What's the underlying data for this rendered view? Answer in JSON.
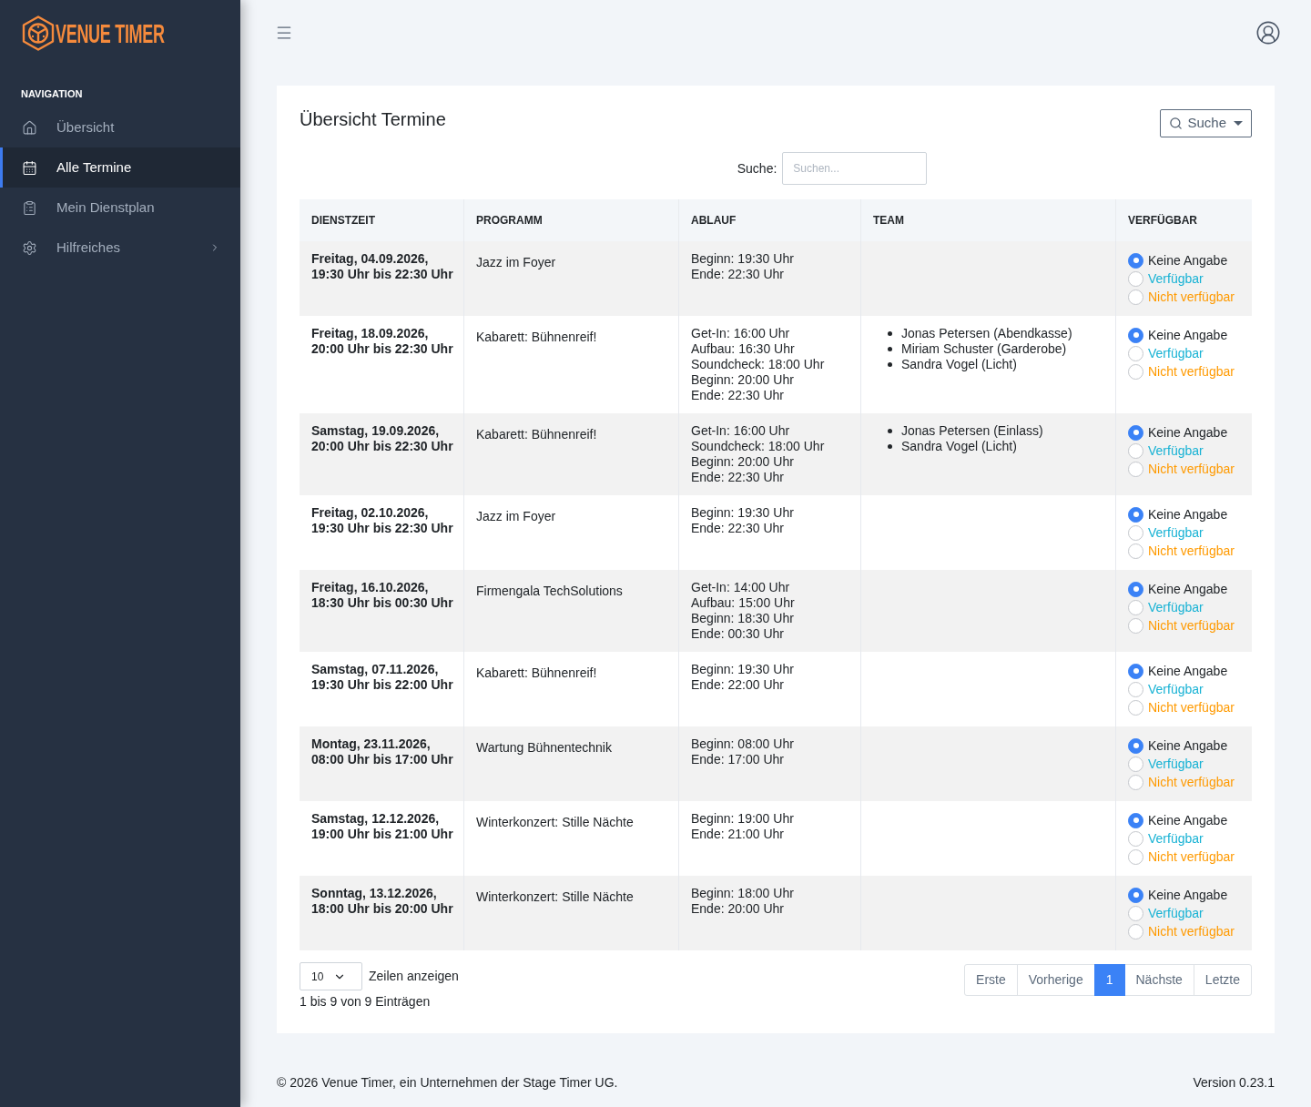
{
  "sidebar": {
    "logo": "VENUE TIMER",
    "section": "NAVIGATION",
    "items": [
      {
        "label": "Übersicht",
        "kind": "link",
        "selected": false
      },
      {
        "label": "Alle Termine",
        "kind": "link",
        "selected": true
      },
      {
        "label": "Mein Dienstplan",
        "kind": "link",
        "selected": false
      },
      {
        "label": "Hilfreiches",
        "kind": "submenu",
        "selected": false
      }
    ]
  },
  "card": {
    "title": "Übersicht Termine",
    "search_button": "Suche",
    "filter": {
      "label": "Suche:",
      "placeholder": "Suchen..."
    },
    "table": {
      "columns": [
        "DIENSTZEIT",
        "PROGRAMM",
        "ABLAUF",
        "TEAM",
        "VERFÜGBAR"
      ],
      "rows": [
        {
          "dienstzeit": [
            "Freitag, 04.09.2026,",
            "19:30 Uhr bis 22:30 Uhr"
          ],
          "programm": "Jazz im Foyer",
          "ablauf": [
            "Beginn: 19:30 Uhr",
            "Ende: 22:30 Uhr"
          ],
          "availability": [
            {
              "label": "Keine Angabe",
              "color": "#212529",
              "selected": true
            },
            {
              "label": "Verfügbar",
              "color": "#17b2d4",
              "selected": false
            },
            {
              "label": "Nicht verfügbar",
              "color": "#ff9a00",
              "selected": false
            }
          ]
        },
        {
          "dienstzeit": [
            "Freitag, 18.09.2026,",
            "20:00 Uhr bis 22:30 Uhr"
          ],
          "programm": "Kabarett: Bühnenreif!",
          "ablauf": [
            "Get-In: 16:00 Uhr",
            "Aufbau: 16:30 Uhr",
            "Soundcheck: 18:00 Uhr",
            "Beginn: 20:00 Uhr",
            "Ende: 22:30 Uhr"
          ],
          "team": [
            "Jonas Petersen (Abendkasse)",
            "Miriam Schuster (Garderobe)",
            "Sandra Vogel (Licht)"
          ],
          "availability": [
            {
              "label": "Keine Angabe",
              "color": "#212529",
              "selected": true
            },
            {
              "label": "Verfügbar",
              "color": "#17b2d4",
              "selected": false
            },
            {
              "label": "Nicht verfügbar",
              "color": "#ff9a00",
              "selected": false
            }
          ]
        },
        {
          "dienstzeit": [
            "Samstag, 19.09.2026,",
            "20:00 Uhr bis 22:30 Uhr"
          ],
          "programm": "Kabarett: Bühnenreif!",
          "ablauf": [
            "Get-In: 16:00 Uhr",
            "Soundcheck: 18:00 Uhr",
            "Beginn: 20:00 Uhr",
            "Ende: 22:30 Uhr"
          ],
          "team": [
            "Jonas Petersen (Einlass)",
            "Sandra Vogel (Licht)"
          ],
          "availability": [
            {
              "label": "Keine Angabe",
              "color": "#212529",
              "selected": true
            },
            {
              "label": "Verfügbar",
              "color": "#17b2d4",
              "selected": false
            },
            {
              "label": "Nicht verfügbar",
              "color": "#ff9a00",
              "selected": false
            }
          ]
        },
        {
          "dienstzeit": [
            "Freitag, 02.10.2026,",
            "19:30 Uhr bis 22:30 Uhr"
          ],
          "programm": "Jazz im Foyer",
          "ablauf": [
            "Beginn: 19:30 Uhr",
            "Ende: 22:30 Uhr"
          ],
          "availability": [
            {
              "label": "Keine Angabe",
              "color": "#212529",
              "selected": true
            },
            {
              "label": "Verfügbar",
              "color": "#17b2d4",
              "selected": false
            },
            {
              "label": "Nicht verfügbar",
              "color": "#ff9a00",
              "selected": false
            }
          ]
        },
        {
          "dienstzeit": [
            "Freitag, 16.10.2026,",
            "18:30 Uhr bis 00:30 Uhr"
          ],
          "programm": "Firmengala TechSolutions",
          "ablauf": [
            "Get-In: 14:00 Uhr",
            "Aufbau: 15:00 Uhr",
            "Beginn: 18:30 Uhr",
            "Ende: 00:30 Uhr"
          ],
          "availability": [
            {
              "label": "Keine Angabe",
              "color": "#212529",
              "selected": true
            },
            {
              "label": "Verfügbar",
              "color": "#17b2d4",
              "selected": false
            },
            {
              "label": "Nicht verfügbar",
              "color": "#ff9a00",
              "selected": false
            }
          ]
        },
        {
          "dienstzeit": [
            "Samstag, 07.11.2026,",
            "19:30 Uhr bis 22:00 Uhr"
          ],
          "programm": "Kabarett: Bühnenreif!",
          "ablauf": [
            "Beginn: 19:30 Uhr",
            "Ende: 22:00 Uhr"
          ],
          "availability": [
            {
              "label": "Keine Angabe",
              "color": "#212529",
              "selected": true
            },
            {
              "label": "Verfügbar",
              "color": "#17b2d4",
              "selected": false
            },
            {
              "label": "Nicht verfügbar",
              "color": "#ff9a00",
              "selected": false
            }
          ]
        },
        {
          "dienstzeit": [
            "Montag, 23.11.2026,",
            "08:00 Uhr bis 17:00 Uhr"
          ],
          "programm": "Wartung Bühnentechnik",
          "ablauf": [
            "Beginn: 08:00 Uhr",
            "Ende: 17:00 Uhr"
          ],
          "availability": [
            {
              "label": "Keine Angabe",
              "color": "#212529",
              "selected": true
            },
            {
              "label": "Verfügbar",
              "color": "#17b2d4",
              "selected": false
            },
            {
              "label": "Nicht verfügbar",
              "color": "#ff9a00",
              "selected": false
            }
          ]
        },
        {
          "dienstzeit": [
            "Samstag, 12.12.2026,",
            "19:00 Uhr bis 21:00 Uhr"
          ],
          "programm": "Winterkonzert: Stille Nächte",
          "ablauf": [
            "Beginn: 19:00 Uhr",
            "Ende: 21:00 Uhr"
          ],
          "availability": [
            {
              "label": "Keine Angabe",
              "color": "#212529",
              "selected": true
            },
            {
              "label": "Verfügbar",
              "color": "#17b2d4",
              "selected": false
            },
            {
              "label": "Nicht verfügbar",
              "color": "#ff9a00",
              "selected": false
            }
          ]
        },
        {
          "dienstzeit": [
            "Sonntag, 13.12.2026,",
            "18:00 Uhr bis 20:00 Uhr"
          ],
          "programm": "Winterkonzert: Stille Nächte",
          "ablauf": [
            "Beginn: 18:00 Uhr",
            "Ende: 20:00 Uhr"
          ],
          "availability": [
            {
              "label": "Keine Angabe",
              "color": "#212529",
              "selected": true
            },
            {
              "label": "Verfügbar",
              "color": "#17b2d4",
              "selected": false
            },
            {
              "label": "Nicht verfügbar",
              "color": "#ff9a00",
              "selected": false
            }
          ]
        }
      ]
    },
    "page_size": {
      "value": "10",
      "label": "Zeilen anzeigen"
    },
    "info": "1 bis 9 von 9 Einträgen",
    "pagination": [
      {
        "label": "Erste",
        "selected": false
      },
      {
        "label": "Vorherige",
        "selected": false
      },
      {
        "label": "1",
        "selected": true
      },
      {
        "label": "Nächste",
        "selected": false
      },
      {
        "label": "Letzte",
        "selected": false
      }
    ]
  },
  "footer": {
    "copyright": "© 2026 Venue Timer, ein Unternehmen der Stage Timer UG.",
    "version": "Version 0.23.1"
  }
}
